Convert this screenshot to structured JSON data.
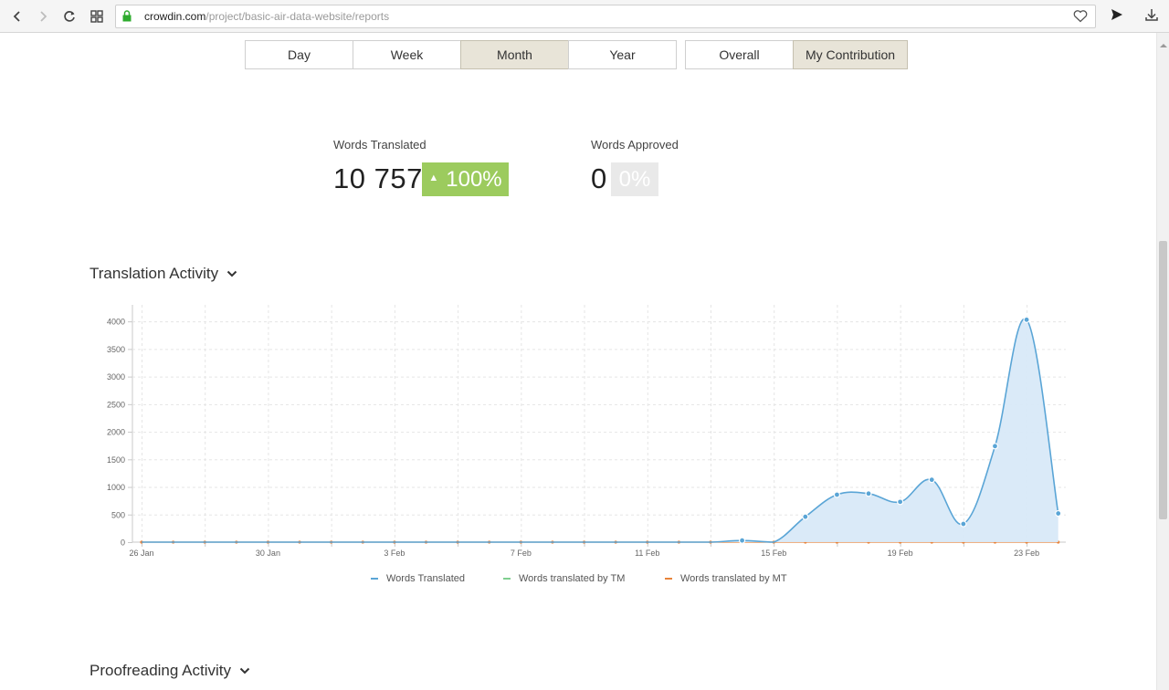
{
  "browser": {
    "url_host": "crowdin.com",
    "url_path": "/project/basic-air-data-website/reports",
    "icons": [
      "back-icon",
      "forward-icon",
      "reload-icon",
      "tabs-grid-icon",
      "lock-icon",
      "heart-icon",
      "send-icon",
      "download-icon"
    ]
  },
  "period_tabs": [
    "Day",
    "Week",
    "Month",
    "Year"
  ],
  "active_period": "Month",
  "scope_tabs": [
    "Overall",
    "My Contribution"
  ],
  "active_scope": "My Contribution",
  "stats": {
    "translated_label": "Words Translated",
    "translated_value": "10 757",
    "translated_change": "100%",
    "approved_label": "Words Approved",
    "approved_value": "0",
    "approved_change": "0%"
  },
  "colors": {
    "accent_green": "#9ccb5e",
    "series_translated": "#5aa5d6",
    "series_tm": "#7fcf8f",
    "series_mt": "#e8833a"
  },
  "sections": {
    "translation_title": "Translation Activity",
    "proofreading_title": "Proofreading Activity"
  },
  "chart_data": {
    "type": "area",
    "title": "",
    "xlabel": "",
    "ylabel": "",
    "x_tick_labels": [
      "26 Jan",
      "30 Jan",
      "3 Feb",
      "7 Feb",
      "11 Feb",
      "15 Feb",
      "19 Feb",
      "23 Feb"
    ],
    "y_ticks": [
      0,
      500,
      1000,
      1500,
      2000,
      2500,
      3000,
      3500,
      4000
    ],
    "ylim": [
      0,
      4300
    ],
    "x_start": "26 Jan",
    "x_end": "24 Feb",
    "grid": true,
    "legend_position": "bottom",
    "series": [
      {
        "name": "Words Translated",
        "x": [
          "26 Jan",
          "27 Jan",
          "28 Jan",
          "29 Jan",
          "30 Jan",
          "31 Jan",
          "1 Feb",
          "2 Feb",
          "3 Feb",
          "4 Feb",
          "5 Feb",
          "6 Feb",
          "7 Feb",
          "8 Feb",
          "9 Feb",
          "10 Feb",
          "11 Feb",
          "12 Feb",
          "13 Feb",
          "14 Feb",
          "15 Feb",
          "16 Feb",
          "17 Feb",
          "18 Feb",
          "19 Feb",
          "20 Feb",
          "21 Feb",
          "22 Feb",
          "23 Feb",
          "24 Feb"
        ],
        "values": [
          0,
          0,
          0,
          0,
          0,
          0,
          0,
          0,
          0,
          0,
          0,
          0,
          0,
          0,
          0,
          0,
          0,
          0,
          0,
          30,
          0,
          460,
          860,
          880,
          730,
          1130,
          330,
          1740,
          4030,
          520
        ]
      },
      {
        "name": "Words translated by TM",
        "x": [
          "26 Jan",
          "24 Feb"
        ],
        "values": [
          0,
          0
        ]
      },
      {
        "name": "Words translated by MT",
        "x": [
          "26 Jan",
          "27 Jan",
          "28 Jan",
          "29 Jan",
          "30 Jan",
          "31 Jan",
          "1 Feb",
          "2 Feb",
          "3 Feb",
          "4 Feb",
          "5 Feb",
          "6 Feb",
          "7 Feb",
          "8 Feb",
          "9 Feb",
          "10 Feb",
          "11 Feb",
          "12 Feb",
          "13 Feb",
          "14 Feb",
          "15 Feb",
          "16 Feb",
          "17 Feb",
          "18 Feb",
          "19 Feb",
          "20 Feb",
          "21 Feb",
          "22 Feb",
          "23 Feb",
          "24 Feb"
        ],
        "values": [
          0,
          0,
          0,
          0,
          0,
          0,
          0,
          0,
          0,
          0,
          0,
          0,
          0,
          0,
          0,
          0,
          0,
          0,
          0,
          0,
          0,
          0,
          0,
          0,
          0,
          0,
          0,
          0,
          0,
          0
        ]
      }
    ]
  }
}
